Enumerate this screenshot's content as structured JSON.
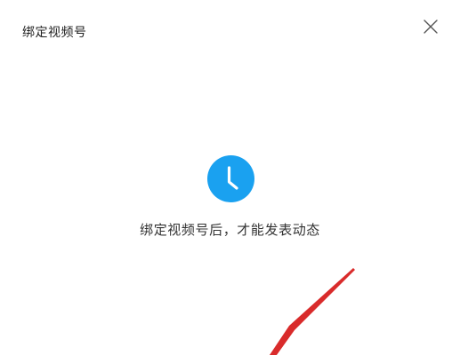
{
  "dialog": {
    "title": "绑定视频号",
    "close_icon": "close-icon",
    "status_icon": "clock-icon",
    "message": "绑定视频号后，才能发表动态"
  },
  "colors": {
    "accent": "#1aa1f0",
    "annotation_arrow": "#d92b2b"
  }
}
